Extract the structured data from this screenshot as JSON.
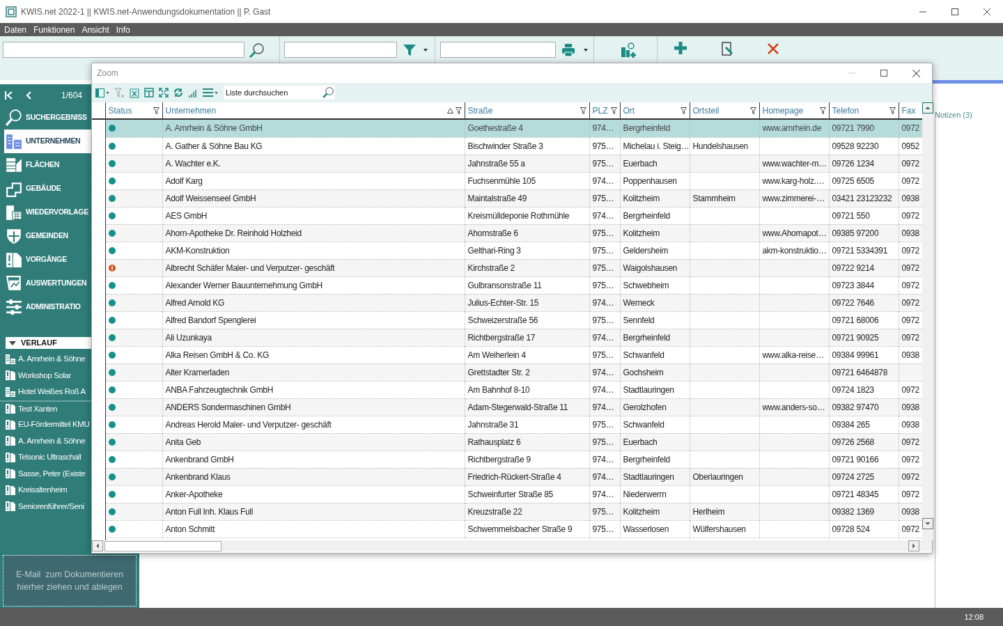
{
  "window": {
    "title": "KWIS.net 2022-1 || KWIS.net-Anwendungsdokumentation || P. Gast"
  },
  "menu": [
    "Daten",
    "Funktionen",
    "Ansicht",
    "Info"
  ],
  "sidebar": {
    "position": "1/604",
    "items": [
      {
        "label": "SUCHERGEBNISS",
        "selected": false
      },
      {
        "label": "UNTERNEHMEN",
        "selected": true
      },
      {
        "label": "FLÄCHEN",
        "selected": false
      },
      {
        "label": "GEBÄUDE",
        "selected": false
      },
      {
        "label": "WIEDERVORLAGE",
        "selected": false
      },
      {
        "label": "GEMEINDEN",
        "selected": false
      },
      {
        "label": "VORGÄNGE",
        "selected": false
      },
      {
        "label": "AUSWERTUNGEN",
        "selected": false
      },
      {
        "label": "ADMINISTRATIO",
        "selected": false
      }
    ],
    "history_title": "VERLAUF",
    "history": [
      {
        "label": "A. Amrhein & Söhne",
        "kind": "company"
      },
      {
        "label": "Workshop Solar",
        "kind": "process"
      },
      {
        "label": "Hotel Weißes Roß A",
        "kind": "company"
      },
      {
        "label": "Test Xanten",
        "kind": "process"
      },
      {
        "label": "EU-Fördermittel KMU",
        "kind": "process"
      },
      {
        "label": "A. Amrhein & Söhne",
        "kind": "process"
      },
      {
        "label": "Telsonic Ultraschall",
        "kind": "process"
      },
      {
        "label": "Sasse, Peter (Existe",
        "kind": "process"
      },
      {
        "label": "Kreisaltenheim",
        "kind": "process"
      },
      {
        "label": "Seniorenführer/Seni",
        "kind": "process"
      }
    ],
    "drop_zone": "E-Mail  zum Dokumentieren\nhierher ziehen und ablegen"
  },
  "notes_tab": "Notizen (3)",
  "dialog": {
    "title": "Zoom",
    "search": {
      "placeholder": "Liste durchsuchen"
    },
    "columns": [
      {
        "label": "Status",
        "sorted": false,
        "filter": true
      },
      {
        "label": "Unternehmen",
        "sorted": true,
        "filter": true
      },
      {
        "label": "Straße",
        "sorted": false,
        "filter": true
      },
      {
        "label": "PLZ",
        "sorted": false,
        "filter": true
      },
      {
        "label": "Ort",
        "sorted": false,
        "filter": true
      },
      {
        "label": "Ortsteil",
        "sorted": false,
        "filter": true
      },
      {
        "label": "Homepage",
        "sorted": false,
        "filter": true
      },
      {
        "label": "Telefon",
        "sorted": false,
        "filter": true
      },
      {
        "label": "Fax",
        "sorted": false,
        "filter": false
      }
    ],
    "rows": [
      {
        "warning": false,
        "selected": true,
        "cells": [
          "",
          "A. Amrhein & Söhne GmbH",
          "Goethestraße 4",
          "974…",
          "Bergrheinfeld",
          "",
          "www.amrhein.de",
          "09721 7990",
          "0972"
        ]
      },
      {
        "warning": false,
        "selected": false,
        "cells": [
          "",
          "A. Gather & Söhne Bau KG",
          "Bischwinder Straße 3",
          "975…",
          "Michelau i. Steig…",
          "Hundelshausen",
          "",
          "09528 92230",
          "0952"
        ]
      },
      {
        "warning": false,
        "selected": false,
        "cells": [
          "",
          "A. Wachter e.K.",
          "Jahnstraße 55 a",
          "975…",
          "Euerbach",
          "",
          "www.wachter-m…",
          "09726 1234",
          "0972"
        ]
      },
      {
        "warning": false,
        "selected": false,
        "cells": [
          "",
          "Adolf Karg",
          "Fuchsenmühle 105",
          "974…",
          "Poppenhausen",
          "",
          "www.karg-holz.…",
          "09725 6505",
          "0972"
        ]
      },
      {
        "warning": false,
        "selected": false,
        "cells": [
          "",
          "Adolf Weissenseel GmbH",
          "Maintalstraße 49",
          "975…",
          "Kolitzheim",
          "Stammheim",
          "www.zimmerei-…",
          "03421 23123232",
          "0938"
        ]
      },
      {
        "warning": false,
        "selected": false,
        "cells": [
          "",
          "AES GmbH",
          "Kreismülldeponie Rothmühle",
          "974…",
          "Bergrheinfeld",
          "",
          "",
          "09721 550",
          "0972"
        ]
      },
      {
        "warning": false,
        "selected": false,
        "cells": [
          "",
          "Ahorn-Apotheke Dr. Reinhold Holzheid",
          "Ahornstraße 6",
          "975…",
          "Kolitzheim",
          "",
          "www.Ahornapot…",
          "09385 97200",
          "0938"
        ]
      },
      {
        "warning": false,
        "selected": false,
        "cells": [
          "",
          "AKM-Konstruktion",
          "Gelthari-Ring 3",
          "975…",
          "Geldersheim",
          "",
          "akm-konstruktio…",
          "09721 5334391",
          "0972"
        ]
      },
      {
        "warning": true,
        "selected": false,
        "cells": [
          "",
          "Albrecht Schäfer Maler- und Verputzer- geschäft",
          "Kirchstraße 2",
          "975…",
          "Waigolshausen",
          "",
          "",
          "09722 9214",
          "0972"
        ]
      },
      {
        "warning": false,
        "selected": false,
        "cells": [
          "",
          "Alexander Werner Bauunternehmung GmbH",
          "Gulbransonstraße 11",
          "975…",
          "Schwebheim",
          "",
          "",
          "09723 3844",
          "0972"
        ]
      },
      {
        "warning": false,
        "selected": false,
        "cells": [
          "",
          "Alfred Arnold KG",
          "Julius-Echter-Str. 15",
          "974…",
          "Werneck",
          "",
          "",
          "09722 7646",
          "0972"
        ]
      },
      {
        "warning": false,
        "selected": false,
        "cells": [
          "",
          "Alfred Bandorf Spenglerei",
          "Schweizerstraße 56",
          "975…",
          "Sennfeld",
          "",
          "",
          "09721 68006",
          "0972"
        ]
      },
      {
        "warning": false,
        "selected": false,
        "cells": [
          "",
          "Ali Uzunkaya",
          "Richtbergstraße 17",
          "974…",
          "Bergrheinfeld",
          "",
          "",
          "09721 90925",
          "0972"
        ]
      },
      {
        "warning": false,
        "selected": false,
        "cells": [
          "",
          "Alka Reisen GmbH & Co. KG",
          "Am Weiherlein 4",
          "975…",
          "Schwanfeld",
          "",
          "www.alka-reise…",
          "09384 99961",
          "0938"
        ]
      },
      {
        "warning": false,
        "selected": false,
        "cells": [
          "",
          "Alter Kramerladen",
          "Grettstadter Str. 2",
          "974…",
          "Gochsheim",
          "",
          "",
          "09721 6464878",
          ""
        ]
      },
      {
        "warning": false,
        "selected": false,
        "cells": [
          "",
          "ANBA Fahrzeugtechnik GmbH",
          "Am Bahnhof 8-10",
          "974…",
          "Stadtlauringen",
          "",
          "",
          "09724 1823",
          "0972"
        ]
      },
      {
        "warning": false,
        "selected": false,
        "cells": [
          "",
          "ANDERS Sondermaschinen GmbH",
          "Adam-Stegerwald-Straße 11",
          "974…",
          "Gerolzhofen",
          "",
          "www.anders-so…",
          "09382 97470",
          "0938"
        ]
      },
      {
        "warning": false,
        "selected": false,
        "cells": [
          "",
          "Andreas Herold Maler- und Verputzer- geschäft",
          "Jahnstraße 31",
          "975…",
          "Schwanfeld",
          "",
          "",
          "09384 265",
          "0938"
        ]
      },
      {
        "warning": false,
        "selected": false,
        "cells": [
          "",
          "Anita Geb",
          "Rathausplatz 6",
          "975…",
          "Euerbach",
          "",
          "",
          "09726 2568",
          "0972"
        ]
      },
      {
        "warning": false,
        "selected": false,
        "cells": [
          "",
          "Ankenbrand GmbH",
          "Richtbergstraße 9",
          "974…",
          "Bergrheinfeld",
          "",
          "",
          "09721 90166",
          "0972"
        ]
      },
      {
        "warning": false,
        "selected": false,
        "cells": [
          "",
          "Ankenbrand Klaus",
          "Friedrich-Rückert-Straße 4",
          "974…",
          "Stadtlauringen",
          "Oberlauringen",
          "",
          "09724 2725",
          "0972"
        ]
      },
      {
        "warning": false,
        "selected": false,
        "cells": [
          "",
          "Anker-Apotheke",
          "Schweinfurter Straße 85",
          "974…",
          "Niederwerrn",
          "",
          "",
          "09721 48345",
          "0972"
        ]
      },
      {
        "warning": false,
        "selected": false,
        "cells": [
          "",
          "Anton Full Inh. Klaus Full",
          "Kreuzstraße 22",
          "975…",
          "Kolitzheim",
          "Herlheim",
          "",
          "09382 1369",
          "0938"
        ]
      },
      {
        "warning": false,
        "selected": false,
        "cells": [
          "",
          "Anton Schmitt",
          "Schwemmelsbacher Straße 9",
          "975…",
          "Wasserlosen",
          "Wülfershausen",
          "",
          "09728 524",
          "0972"
        ]
      }
    ]
  },
  "status_bar": {
    "time": "12:08"
  }
}
